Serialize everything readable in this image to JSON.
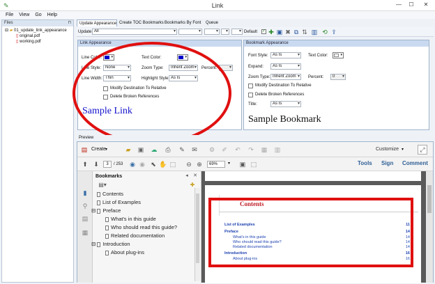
{
  "window": {
    "title": "Link"
  },
  "menu": [
    "File",
    "View",
    "Go",
    "Help"
  ],
  "files": {
    "header": "Files",
    "tree": [
      {
        "label": "01_update_link_appearance",
        "type": "folder"
      },
      {
        "label": "original.pdf",
        "type": "file"
      },
      {
        "label": "working.pdf",
        "type": "file"
      }
    ]
  },
  "tabs": [
    "Update Appearance",
    "Create TOC Bookmarks",
    "Bookmarks By Font",
    "Queue"
  ],
  "toolbar": {
    "update_label": "Update",
    "update_value": "All",
    "default_label": "Default"
  },
  "link_appearance": {
    "header": "Link Appearance",
    "line_color_label": "Line Color:",
    "line_color": "#0000cc",
    "text_color_label": "Text Color:",
    "text_color": "#0000cc",
    "line_style_label": "Line Style:",
    "line_style_value": "None",
    "zoom_type_label": "Zoom Type:",
    "zoom_type_value": "Inherit Zoom",
    "percent_label": "Percent:",
    "line_width_label": "Line Width:",
    "line_width_value": "Thin",
    "highlight_style_label": "Highlight Style:",
    "highlight_style_value": "As Is",
    "modify_dest": "Modify Destination To Relative",
    "delete_broken": "Delete Broken References",
    "sample": "Sample Link"
  },
  "bookmark_appearance": {
    "header": "Bookmark Appearance",
    "font_style_label": "Font Style:",
    "font_style_value": "As Is",
    "text_color_label": "Text Color:",
    "expand_label": "Expand:",
    "expand_value": "As Is",
    "zoom_type_label": "Zoom Type:",
    "zoom_type_value": "Inherit Zoom",
    "percent_label": "Percent:",
    "percent_value": "0",
    "modify_dest": "Modify Destination To Relative",
    "delete_broken": "Delete Broken References",
    "title_label": "Title:",
    "title_value": "As Is",
    "sample": "Sample Bookmark"
  },
  "preview": {
    "header": "Preview",
    "create_label": "Create",
    "customize_label": "Customize",
    "page_current": "3",
    "page_total": "/ 253",
    "zoom": "69%",
    "tools": "Tools",
    "sign": "Sign",
    "comment": "Comment",
    "bookmarks_title": "Bookmarks",
    "bookmarks": [
      {
        "label": "Contents",
        "level": 0,
        "expander": ""
      },
      {
        "label": "List of Examples",
        "level": 0,
        "expander": ""
      },
      {
        "label": "Preface",
        "level": 0,
        "expander": "⊟"
      },
      {
        "label": "What's in this guide",
        "level": 1,
        "expander": ""
      },
      {
        "label": "Who should read this guide?",
        "level": 1,
        "expander": ""
      },
      {
        "label": "Related documentation",
        "level": 1,
        "expander": ""
      },
      {
        "label": "Introduction",
        "level": 0,
        "expander": "⊟"
      },
      {
        "label": "About plug-ins",
        "level": 1,
        "expander": ""
      }
    ],
    "doc": {
      "heading": "Contents",
      "toc": [
        {
          "text": "List of Examples",
          "page": "11",
          "bold": true
        },
        {
          "text": "Preface",
          "page": "14",
          "bold": true
        },
        {
          "text": "What's in this guide",
          "page": "14",
          "bold": false
        },
        {
          "text": "Who should read this guide?",
          "page": "14",
          "bold": false
        },
        {
          "text": "Related documentation",
          "page": "14",
          "bold": false
        },
        {
          "text": "Introduction",
          "page": "16",
          "bold": true
        },
        {
          "text": "About plug-ins",
          "page": "16",
          "bold": false
        }
      ]
    }
  },
  "annotations": {
    "circle_color": "#e01010",
    "box_color": "#e01010"
  }
}
